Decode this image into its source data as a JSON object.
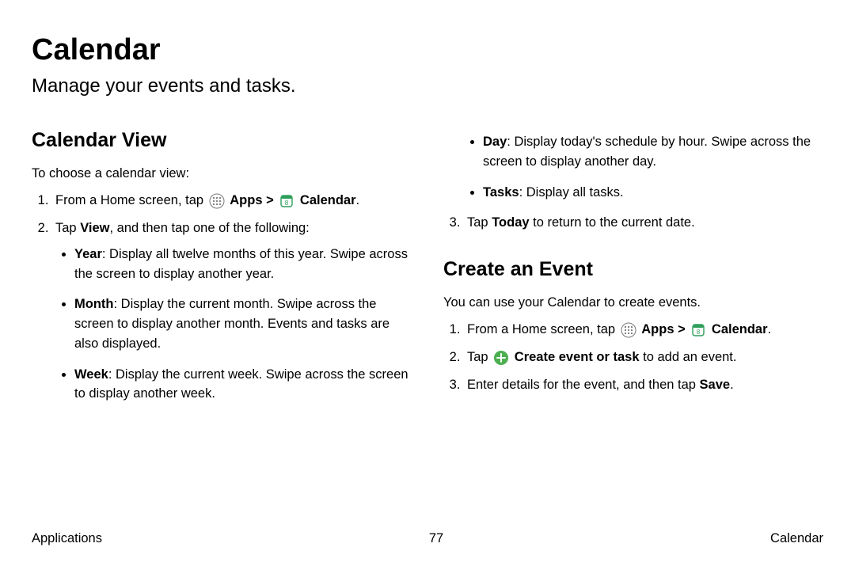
{
  "title": "Calendar",
  "subtitle": "Manage your events and tasks.",
  "section1": {
    "heading": "Calendar View",
    "intro": "To choose a calendar view:",
    "step1_a": "From a Home screen, tap ",
    "step1_apps": "Apps",
    "step1_arrow": " > ",
    "step1_calendar": "Calendar",
    "step1_end": ".",
    "step2_a": "Tap ",
    "step2_view": "View",
    "step2_b": ", and then tap one of the following:",
    "bullet_year_label": "Year",
    "bullet_year_text": ": Display all twelve months of this year. Swipe across the screen to display another year.",
    "bullet_month_label": "Month",
    "bullet_month_text": ": Display the current month. Swipe across the screen to display another month. Events and tasks are also displayed.",
    "bullet_week_label": "Week",
    "bullet_week_text": ": Display the current week. Swipe across the screen to display another week.",
    "bullet_day_label": "Day",
    "bullet_day_text": ": Display today's schedule by hour. Swipe across the screen to display another day.",
    "bullet_tasks_label": "Tasks",
    "bullet_tasks_text": ": Display all tasks.",
    "step3_a": "Tap ",
    "step3_today": "Today",
    "step3_b": " to return to the current date."
  },
  "section2": {
    "heading": "Create an Event",
    "intro": "You can use your Calendar to create events.",
    "step1_a": "From a Home screen, tap ",
    "step1_apps": "Apps",
    "step1_arrow": " > ",
    "step1_calendar": "Calendar",
    "step1_end": ".",
    "step2_a": "Tap ",
    "step2_label": "Create event or task",
    "step2_b": " to add an event.",
    "step3_a": "Enter details for the event, and then tap ",
    "step3_save": "Save",
    "step3_b": "."
  },
  "footer": {
    "left": "Applications",
    "page": "77",
    "right": "Calendar"
  }
}
